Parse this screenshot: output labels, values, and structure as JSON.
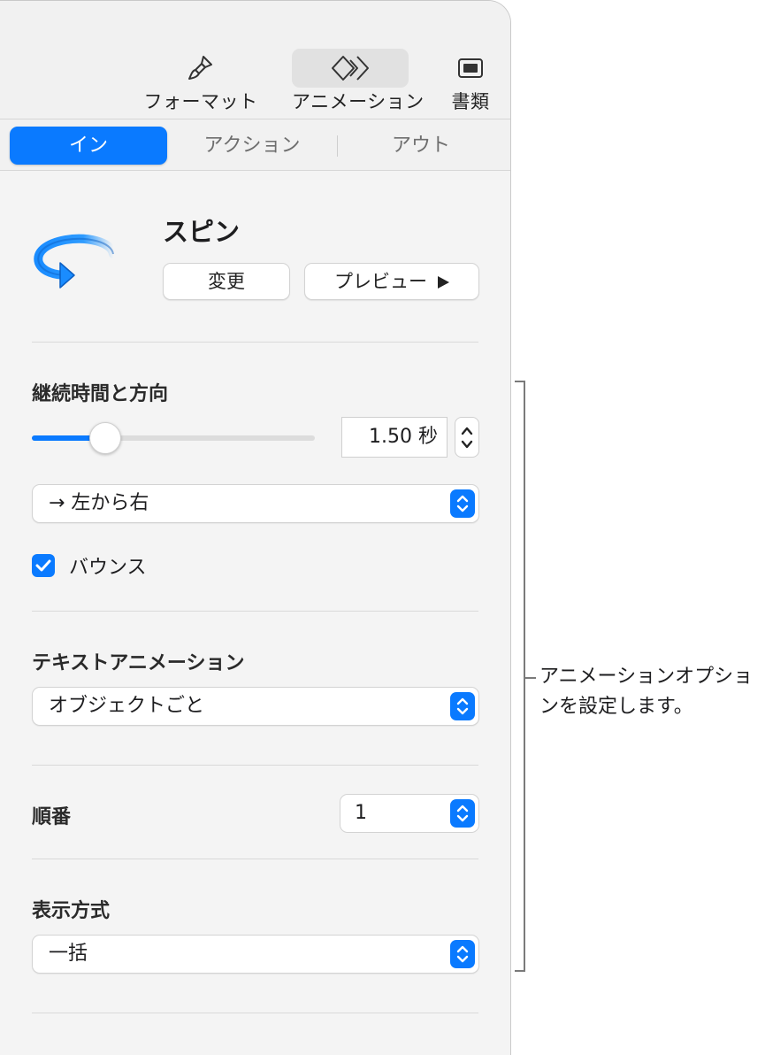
{
  "toolbar": {
    "format_label": "フォーマット",
    "animation_label": "アニメーション",
    "document_label": "書類",
    "active": "animation"
  },
  "tabs": {
    "items": [
      "イン",
      "アクション",
      "アウト"
    ],
    "selected": "イン"
  },
  "effect": {
    "name": "スピン",
    "icon": "spin-arrow-icon",
    "change_label": "変更",
    "preview_label": "プレビュー"
  },
  "duration_direction": {
    "title": "継続時間と方向",
    "slider_fraction": 0.26,
    "duration_value": "1.50",
    "duration_unit": "秒",
    "direction_value": "→ 左から右",
    "bounce_label": "バウンス",
    "bounce_checked": true
  },
  "text_animation": {
    "title": "テキストアニメーション",
    "value": "オブジェクトごと"
  },
  "order": {
    "label": "順番",
    "value": "1"
  },
  "delivery": {
    "title": "表示方式",
    "value": "一括"
  },
  "callout": {
    "text": "アニメーションオプションを設定します。"
  },
  "colors": {
    "accent": "#0a7aff",
    "panel_bg": "#f4f4f4"
  }
}
